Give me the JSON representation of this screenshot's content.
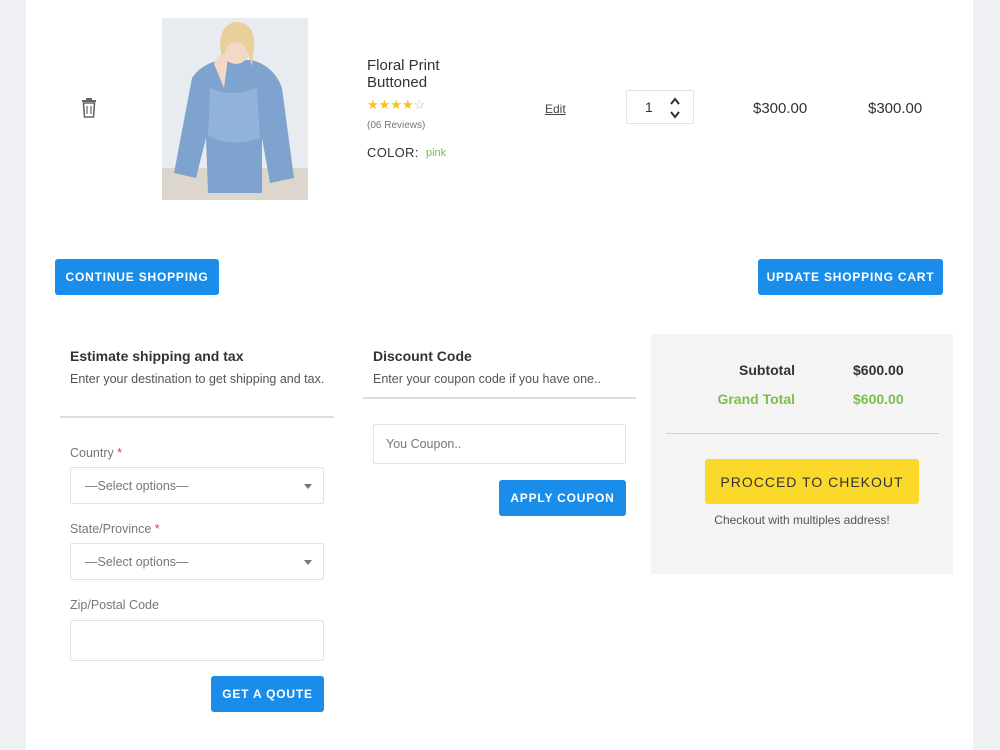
{
  "cart_item": {
    "name": "Floral Print Buttoned",
    "rating": 4,
    "rating_max": 5,
    "reviews": "(06 Reviews)",
    "color_label": "COLOR:",
    "color_value": "pink",
    "edit_label": "Edit",
    "quantity": "1",
    "unit_price": "$300.00",
    "total_price": "$300.00"
  },
  "actions": {
    "continue_label": "CONTINUE SHOPPING",
    "update_label": "UPDATE SHOPPING CART"
  },
  "shipping": {
    "title": "Estimate shipping and tax",
    "description": "Enter your destination to get shipping and tax.",
    "country_label": "Country",
    "country_value": "—Select options—",
    "state_label": "State/Province",
    "state_value": "—Select options—",
    "zip_label": "Zip/Postal Code",
    "zip_value": "",
    "quote_label": "GET A QOUTE"
  },
  "discount": {
    "title": "Discount Code",
    "description": "Enter your coupon code if you have one..",
    "placeholder": "You Coupon..",
    "apply_label": "APPLY COUPON"
  },
  "totals": {
    "subtotal_label": "Subtotal",
    "subtotal_value": "$600.00",
    "grand_label": "Grand Total",
    "grand_value": "$600.00",
    "checkout_label": "PROCCED TO CHEKOUT",
    "multi_label": "Checkout with multiples address!"
  },
  "colors": {
    "accent_blue": "#1a8ce9",
    "checkout_yellow": "#fbd92b",
    "grand_green": "#7bbf4a",
    "star_gold": "#f6c21d"
  }
}
